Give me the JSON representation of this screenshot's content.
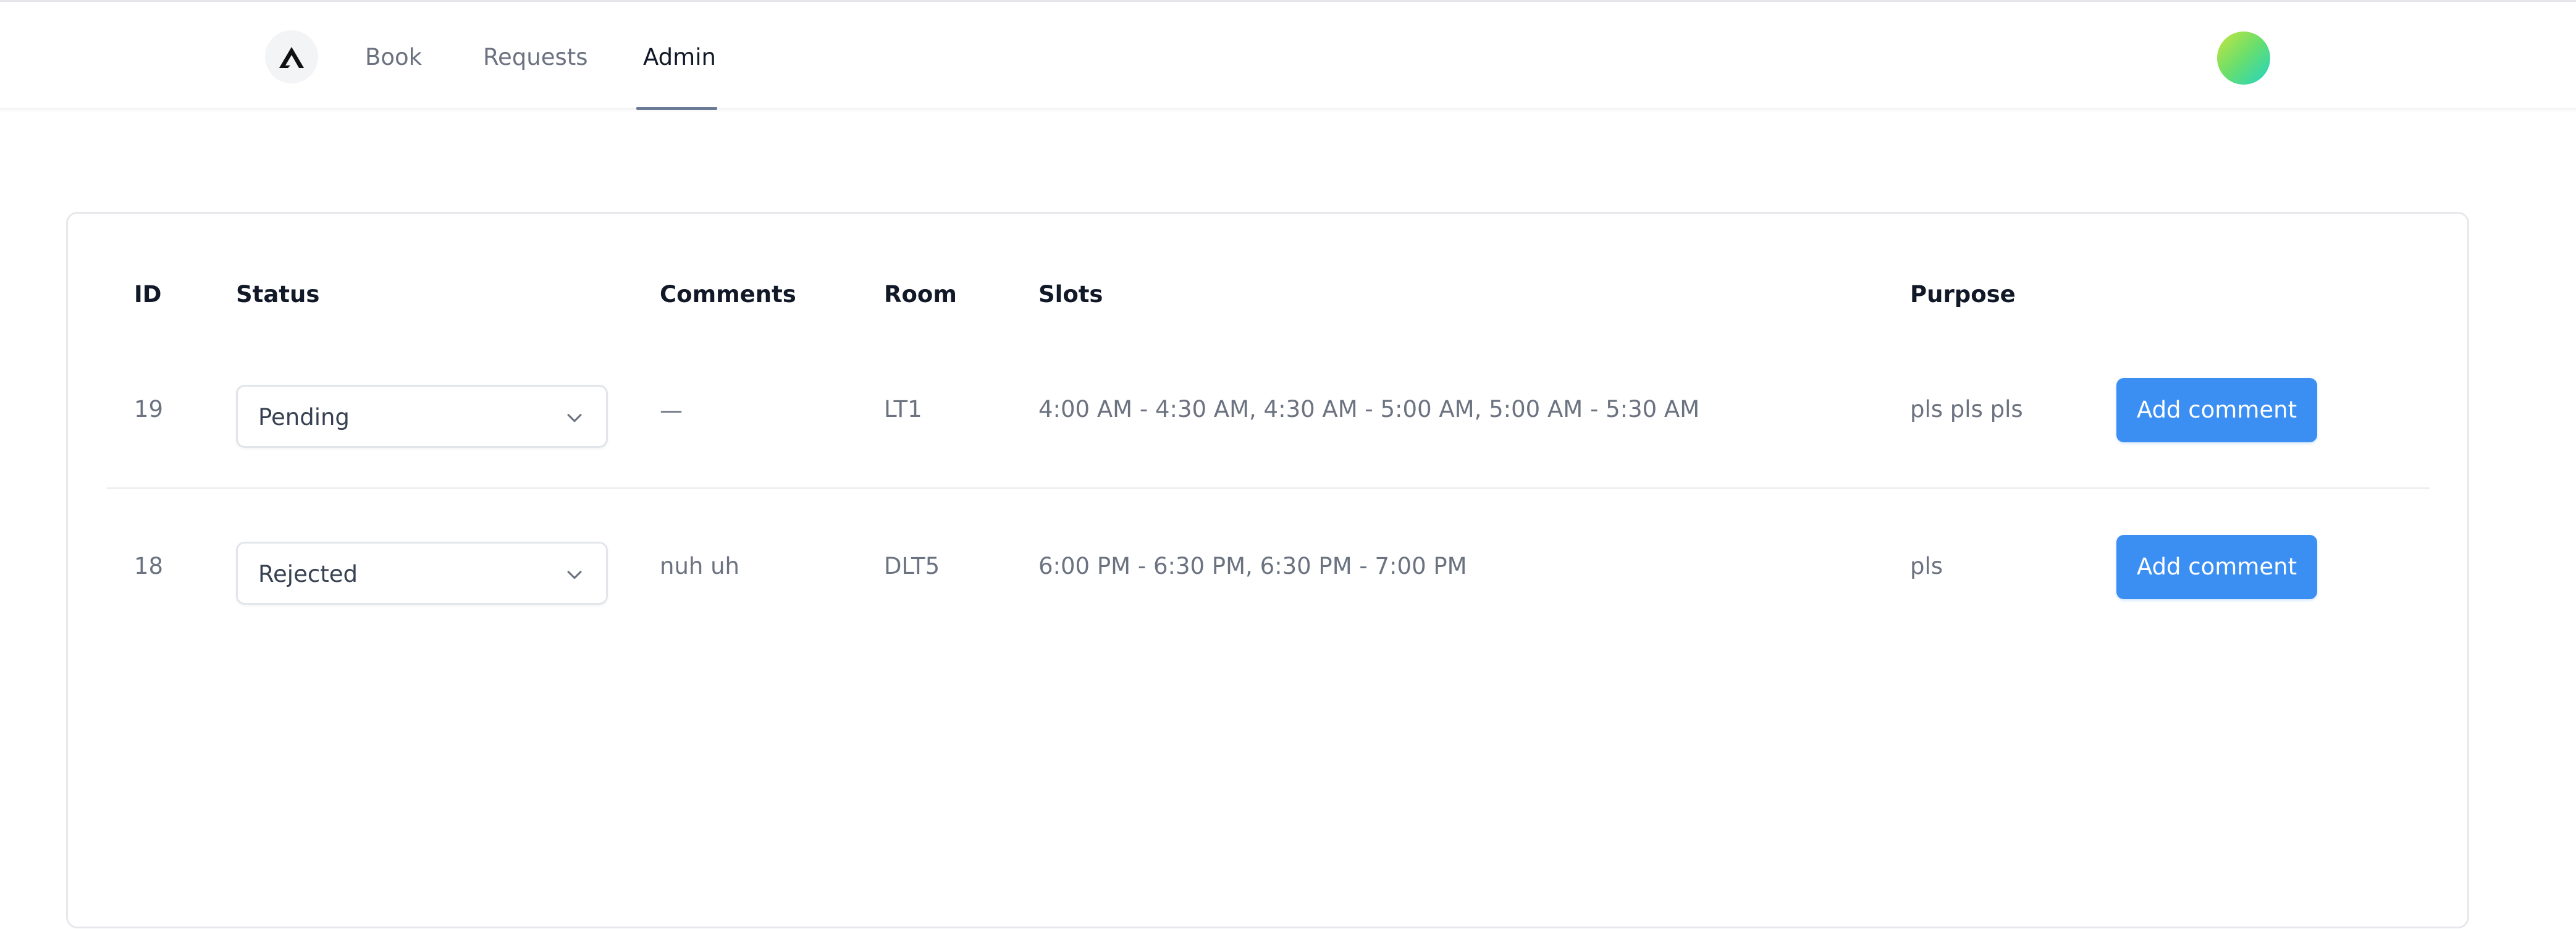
{
  "nav": {
    "links": [
      {
        "label": "Book"
      },
      {
        "label": "Requests"
      },
      {
        "label": "Admin"
      }
    ],
    "active": "Admin"
  },
  "table": {
    "headers": {
      "id": "ID",
      "status": "Status",
      "comments": "Comments",
      "room": "Room",
      "slots": "Slots",
      "purpose": "Purpose"
    },
    "rows": [
      {
        "id": "19",
        "status": "Pending",
        "comments": "—",
        "room": "LT1",
        "slots": "4:00 AM - 4:30 AM, 4:30 AM - 5:00 AM, 5:00 AM - 5:30 AM",
        "purpose": "pls pls pls",
        "action": "Add comment"
      },
      {
        "id": "18",
        "status": "Rejected",
        "comments": "nuh uh",
        "room": "DLT5",
        "slots": "6:00 PM - 6:30 PM, 6:30 PM - 7:00 PM",
        "purpose": "pls",
        "action": "Add comment"
      }
    ]
  },
  "colors": {
    "accent": "#3b8ff3",
    "active_underline": "#6b7b95",
    "muted_text": "#6b7280"
  },
  "icons": {
    "logo": "triangle-logo-icon",
    "dropdown": "chevron-down-icon",
    "avatar": "gradient-avatar"
  }
}
